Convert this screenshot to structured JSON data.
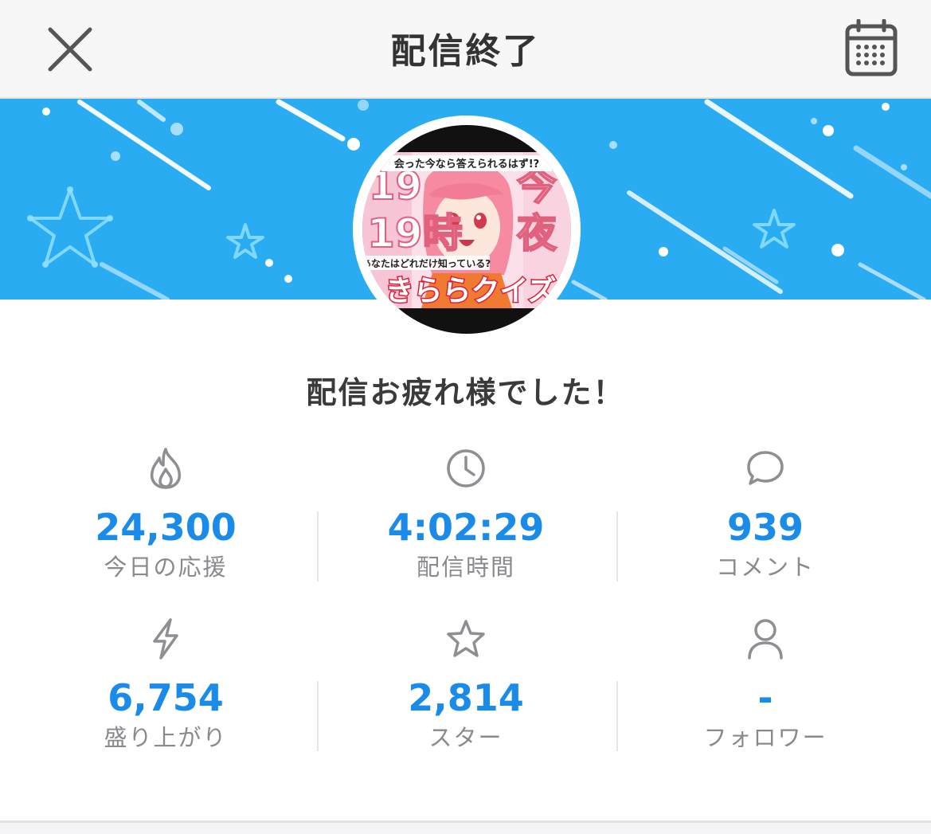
{
  "header": {
    "title": "配信終了",
    "close_icon": "close-icon",
    "calendar_icon": "calendar-icon"
  },
  "banner": {
    "background_color": "#29acf2",
    "thumbnail": {
      "text_top": "会った今なら答えられるはず!?",
      "text_left": "19時",
      "text_right": "今夜",
      "text_question": "あなたはどれだけ知っている?",
      "text_bottom": "きららクイズ"
    }
  },
  "greeting": "配信お疲れ様でした！",
  "stats": [
    {
      "icon": "flame-icon",
      "value": "24,300",
      "label": "今日の応援"
    },
    {
      "icon": "clock-icon",
      "value": "4:02:29",
      "label": "配信時間"
    },
    {
      "icon": "comment-icon",
      "value": "939",
      "label": "コメント"
    },
    {
      "icon": "lightning-icon",
      "value": "6,754",
      "label": "盛り上がり"
    },
    {
      "icon": "star-icon",
      "value": "2,814",
      "label": "スター"
    },
    {
      "icon": "person-icon",
      "value": "-",
      "label": "フォロワー"
    }
  ],
  "colors": {
    "accent": "#1a8be8",
    "label_gray": "#8a8a8e",
    "icon_gray": "#8e8e93"
  }
}
